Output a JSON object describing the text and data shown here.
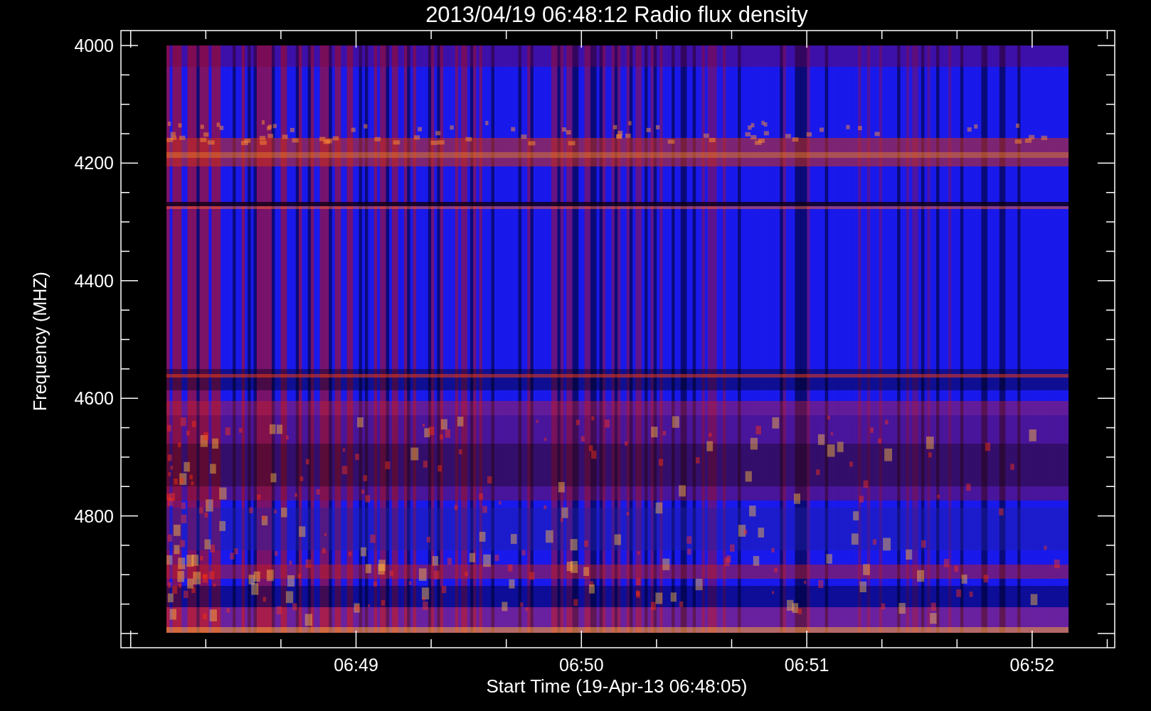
{
  "title": "2013/04/19 06:48:12 Radio flux density",
  "y_axis": {
    "label": "Frequency (MHZ)",
    "ticks": [
      "4000",
      "4200",
      "4400",
      "4600",
      "4800"
    ]
  },
  "x_axis": {
    "label": "Start Time (19-Apr-13 06:48:05)",
    "ticks": [
      "06:49",
      "06:50",
      "06:51",
      "06:52"
    ]
  }
}
